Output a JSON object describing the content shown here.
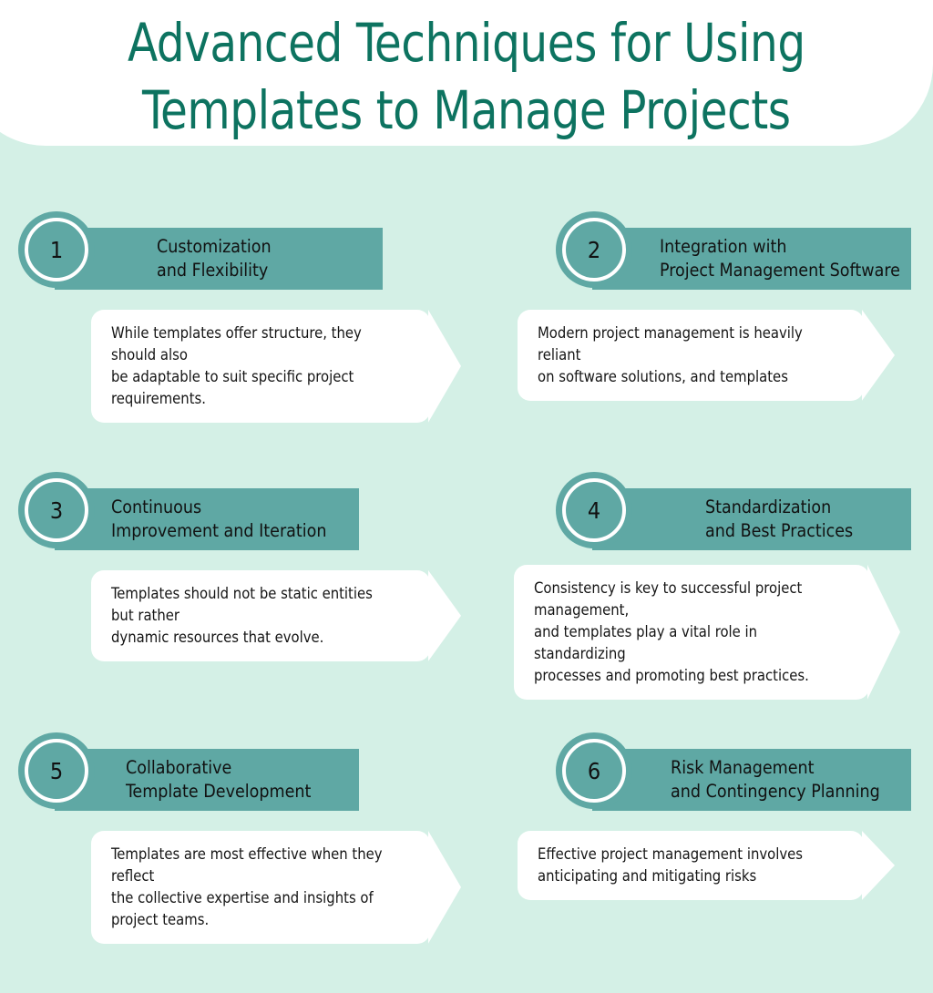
{
  "page": {
    "background_color": "#d4f0e6",
    "title": "Advanced Techniques for Using\nTemplates to Manage Projects",
    "title_color": "#0d7360",
    "accent_color": "#5fa8a4",
    "card_color": "#ffffff",
    "body_text_color": "#151515"
  },
  "items": [
    {
      "number": "1",
      "heading": "Customization\nand Flexibility",
      "description": "While templates offer structure, they should also\nbe adaptable to suit specific project requirements."
    },
    {
      "number": "2",
      "heading": "Integration with\nProject Management Software",
      "description": "Modern project management is heavily reliant\non software solutions, and templates"
    },
    {
      "number": "3",
      "heading": "Continuous\nImprovement and Iteration",
      "description": "Templates should not be static entities but rather\ndynamic resources that evolve."
    },
    {
      "number": "4",
      "heading": "Standardization\nand Best Practices",
      "description": "Consistency is key to successful project management,\nand templates play a vital role in standardizing\nprocesses and promoting best practices."
    },
    {
      "number": "5",
      "heading": "Collaborative\nTemplate Development",
      "description": "Templates are most effective when they reflect\nthe collective expertise and insights of project teams."
    },
    {
      "number": "6",
      "heading": "Risk Management\nand Contingency Planning",
      "description": "Effective project management involves\nanticipating and mitigating risks"
    }
  ]
}
